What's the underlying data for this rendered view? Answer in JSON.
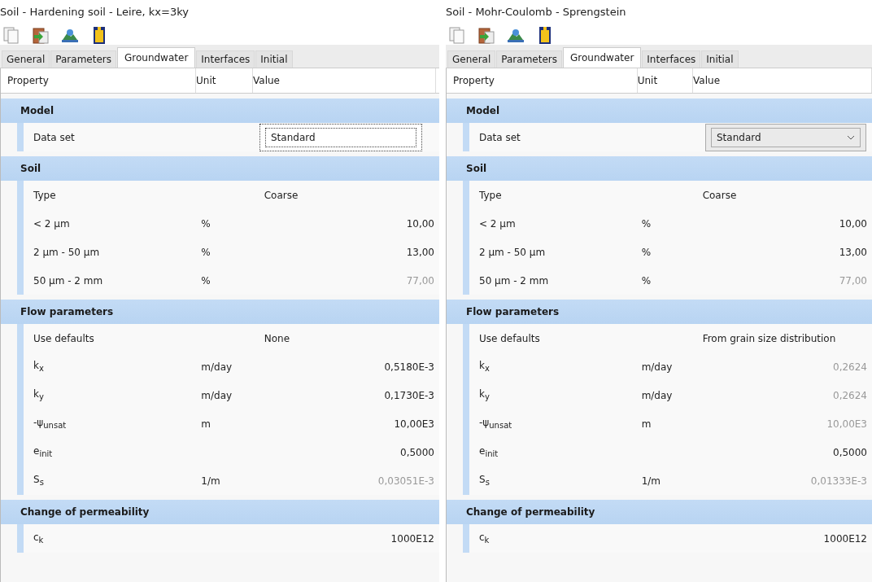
{
  "panels": [
    {
      "title": "Soil - Hardening soil - Leire, kx=3ky",
      "tabs": [
        {
          "label": "General",
          "selected": false
        },
        {
          "label": "Parameters",
          "selected": false
        },
        {
          "label": "Groundwater",
          "selected": true
        },
        {
          "label": "Interfaces",
          "selected": false
        },
        {
          "label": "Initial",
          "selected": false
        }
      ],
      "columns": [
        "Property",
        "Unit",
        "Value"
      ],
      "groups": [
        {
          "title": "Model",
          "rows": [
            {
              "name": "Data set",
              "unit": "",
              "value": "Standard",
              "kind": "field",
              "disabled": false
            }
          ]
        },
        {
          "title": "Soil",
          "rows": [
            {
              "name": "Type",
              "unit": "",
              "value": "Coarse",
              "kind": "text",
              "disabled": false
            },
            {
              "name": "< 2 µm",
              "unit": "%",
              "value": "10,00",
              "kind": "number",
              "disabled": false
            },
            {
              "name": "2 µm - 50 µm",
              "unit": "%",
              "value": "13,00",
              "kind": "number",
              "disabled": false
            },
            {
              "name": "50 µm - 2 mm",
              "unit": "%",
              "value": "77,00",
              "kind": "number",
              "disabled": true
            }
          ]
        },
        {
          "title": "Flow parameters",
          "rows": [
            {
              "name": "Use defaults",
              "unit": "",
              "value": "None",
              "kind": "text",
              "disabled": false
            },
            {
              "name": "k$_{x}$",
              "unit": "m/day",
              "value": "0,5180E-3",
              "kind": "number",
              "disabled": false
            },
            {
              "name": "k$_{y}$",
              "unit": "m/day",
              "value": "0,1730E-3",
              "kind": "number",
              "disabled": false
            },
            {
              "name": "-ψ$_{unsat}$",
              "unit": "m",
              "value": "10,00E3",
              "kind": "number",
              "disabled": false
            },
            {
              "name": "e$_{init}$",
              "unit": "",
              "value": "0,5000",
              "kind": "number",
              "disabled": false
            },
            {
              "name": "S$_{s}$",
              "unit": "1/m",
              "value": "0,03051E-3",
              "kind": "number",
              "disabled": true
            }
          ]
        },
        {
          "title": "Change of permeability",
          "rows": [
            {
              "name": "c$_{k}$",
              "unit": "",
              "value": "1000E12",
              "kind": "number",
              "disabled": false
            }
          ]
        }
      ]
    },
    {
      "title": "Soil - Mohr-Coulomb - Sprengstein",
      "tabs": [
        {
          "label": "General",
          "selected": false
        },
        {
          "label": "Parameters",
          "selected": false
        },
        {
          "label": "Groundwater",
          "selected": true
        },
        {
          "label": "Interfaces",
          "selected": false
        },
        {
          "label": "Initial",
          "selected": false
        }
      ],
      "columns": [
        "Property",
        "Unit",
        "Value"
      ],
      "groups": [
        {
          "title": "Model",
          "rows": [
            {
              "name": "Data set",
              "unit": "",
              "value": "Standard",
              "kind": "dropdown",
              "disabled": false
            }
          ]
        },
        {
          "title": "Soil",
          "rows": [
            {
              "name": "Type",
              "unit": "",
              "value": "Coarse",
              "kind": "text",
              "disabled": false
            },
            {
              "name": "< 2 µm",
              "unit": "%",
              "value": "10,00",
              "kind": "number",
              "disabled": false
            },
            {
              "name": "2 µm - 50 µm",
              "unit": "%",
              "value": "13,00",
              "kind": "number",
              "disabled": false
            },
            {
              "name": "50 µm - 2 mm",
              "unit": "%",
              "value": "77,00",
              "kind": "number",
              "disabled": true
            }
          ]
        },
        {
          "title": "Flow parameters",
          "rows": [
            {
              "name": "Use defaults",
              "unit": "",
              "value": "From grain size distribution",
              "kind": "text",
              "disabled": false
            },
            {
              "name": "k$_{x}$",
              "unit": "m/day",
              "value": "0,2624",
              "kind": "number",
              "disabled": true
            },
            {
              "name": "k$_{y}$",
              "unit": "m/day",
              "value": "0,2624",
              "kind": "number",
              "disabled": true
            },
            {
              "name": "-ψ$_{unsat}$",
              "unit": "m",
              "value": "10,00E3",
              "kind": "number",
              "disabled": true
            },
            {
              "name": "e$_{init}$",
              "unit": "",
              "value": "0,5000",
              "kind": "number",
              "disabled": false
            },
            {
              "name": "S$_{s}$",
              "unit": "1/m",
              "value": "0,01333E-3",
              "kind": "number",
              "disabled": true
            }
          ]
        },
        {
          "title": "Change of permeability",
          "rows": [
            {
              "name": "c$_{k}$",
              "unit": "",
              "value": "1000E12",
              "kind": "number",
              "disabled": false
            }
          ]
        }
      ]
    }
  ]
}
